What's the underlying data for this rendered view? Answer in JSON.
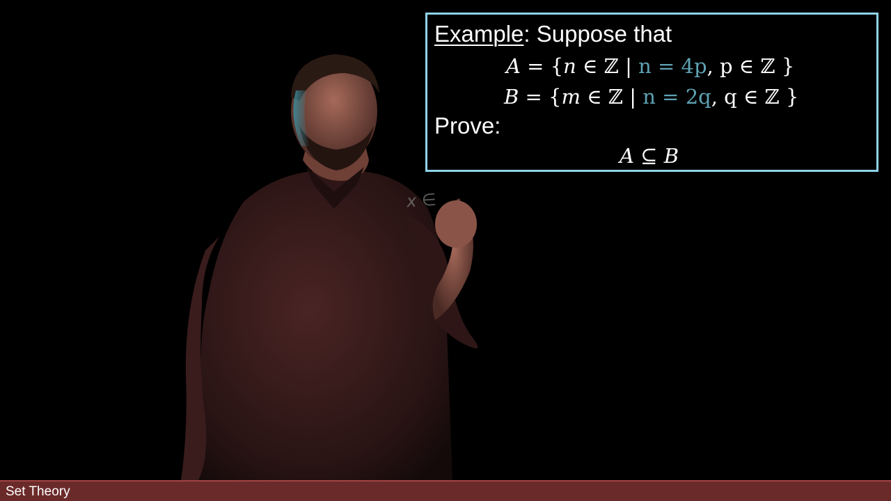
{
  "example": {
    "label": "Example",
    "rest": ": Suppose that",
    "set_a": {
      "lhs": "A",
      "eq": " = {",
      "var": "n",
      "in_z": " ∈ ℤ | ",
      "cond": "n = 4p",
      "sep": ", p ∈ ℤ }"
    },
    "set_b": {
      "lhs": "B",
      "eq": " = {",
      "var": "m",
      "in_z": " ∈ ℤ | ",
      "cond": "n = 2q",
      "sep": ", q ∈ ℤ }"
    },
    "prove_label": "Prove:",
    "claim": {
      "left": "A",
      "op": " ⊆ ",
      "right": "B"
    }
  },
  "handwriting": "x ∈",
  "footer": {
    "title": "Set Theory"
  },
  "colors": {
    "box_border": "#8fd3e6",
    "highlight": "#5fa3b3",
    "footer_bg": "#6b2a2a"
  }
}
